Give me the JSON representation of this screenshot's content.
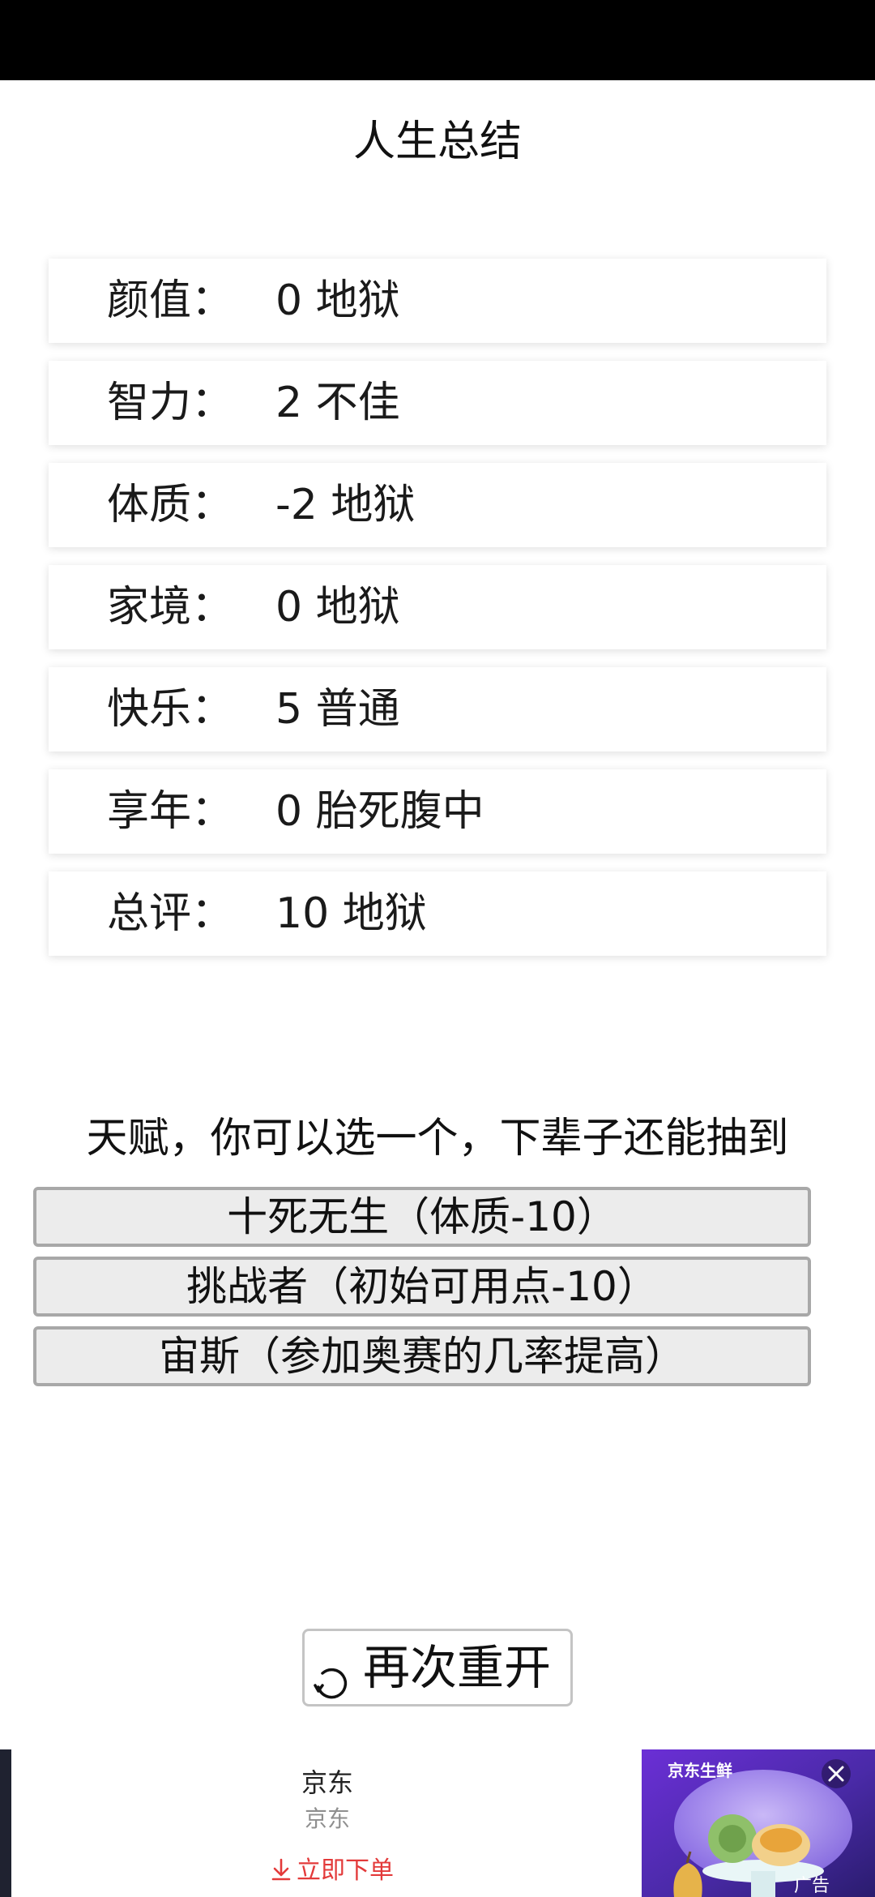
{
  "page": {
    "title": "人生总结"
  },
  "stats": [
    {
      "label": "颜值：",
      "value": "0 地狱"
    },
    {
      "label": "智力：",
      "value": "2 不佳"
    },
    {
      "label": "体质：",
      "value": "-2 地狱"
    },
    {
      "label": "家境：",
      "value": "0 地狱"
    },
    {
      "label": "快乐：",
      "value": "5 普通"
    },
    {
      "label": "享年：",
      "value": "0 胎死腹中"
    },
    {
      "label": "总评：",
      "value": "10 地狱"
    }
  ],
  "talents": {
    "heading": "天赋，你可以选一个，下辈子还能抽到",
    "options": [
      {
        "label": "十死无生（体质-10）"
      },
      {
        "label": "挑战者（初始可用点-10）"
      },
      {
        "label": "宙斯（参加奥赛的几率提高）"
      }
    ]
  },
  "restart": {
    "label": "再次重开",
    "icon": "refresh-icon"
  },
  "ad": {
    "title": "京东",
    "subtitle": "京东",
    "cta": "立即下单",
    "image_brand": "京东生鲜",
    "badge": "广告",
    "close_icon": "close-icon",
    "download_icon": "download-arrow-icon"
  },
  "colors": {
    "status_bar": "#000000",
    "button_bg": "#ececec",
    "ad_cta": "#e33a3a"
  }
}
